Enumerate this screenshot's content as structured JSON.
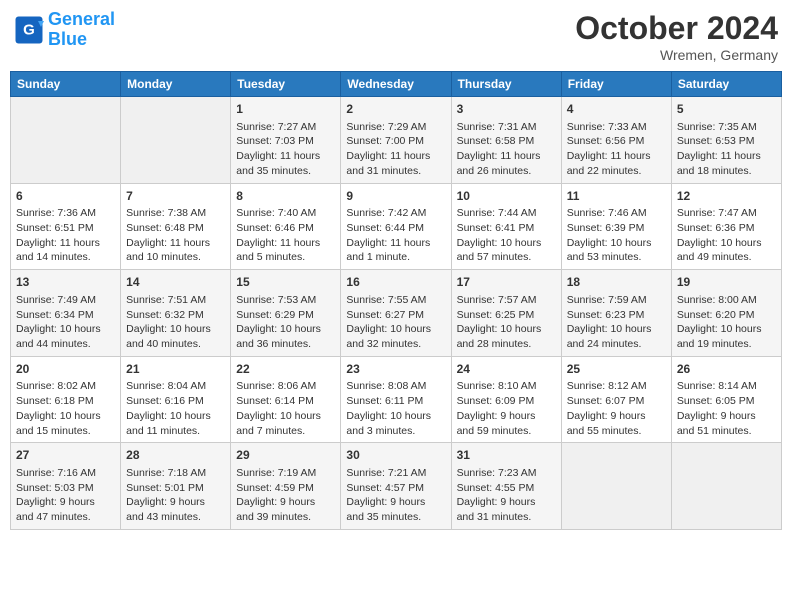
{
  "header": {
    "logo_line1": "General",
    "logo_line2": "Blue",
    "month": "October 2024",
    "location": "Wremen, Germany"
  },
  "weekdays": [
    "Sunday",
    "Monday",
    "Tuesday",
    "Wednesday",
    "Thursday",
    "Friday",
    "Saturday"
  ],
  "weeks": [
    [
      {
        "day": "",
        "info": ""
      },
      {
        "day": "",
        "info": ""
      },
      {
        "day": "1",
        "info": "Sunrise: 7:27 AM\nSunset: 7:03 PM\nDaylight: 11 hours and 35 minutes."
      },
      {
        "day": "2",
        "info": "Sunrise: 7:29 AM\nSunset: 7:00 PM\nDaylight: 11 hours and 31 minutes."
      },
      {
        "day": "3",
        "info": "Sunrise: 7:31 AM\nSunset: 6:58 PM\nDaylight: 11 hours and 26 minutes."
      },
      {
        "day": "4",
        "info": "Sunrise: 7:33 AM\nSunset: 6:56 PM\nDaylight: 11 hours and 22 minutes."
      },
      {
        "day": "5",
        "info": "Sunrise: 7:35 AM\nSunset: 6:53 PM\nDaylight: 11 hours and 18 minutes."
      }
    ],
    [
      {
        "day": "6",
        "info": "Sunrise: 7:36 AM\nSunset: 6:51 PM\nDaylight: 11 hours and 14 minutes."
      },
      {
        "day": "7",
        "info": "Sunrise: 7:38 AM\nSunset: 6:48 PM\nDaylight: 11 hours and 10 minutes."
      },
      {
        "day": "8",
        "info": "Sunrise: 7:40 AM\nSunset: 6:46 PM\nDaylight: 11 hours and 5 minutes."
      },
      {
        "day": "9",
        "info": "Sunrise: 7:42 AM\nSunset: 6:44 PM\nDaylight: 11 hours and 1 minute."
      },
      {
        "day": "10",
        "info": "Sunrise: 7:44 AM\nSunset: 6:41 PM\nDaylight: 10 hours and 57 minutes."
      },
      {
        "day": "11",
        "info": "Sunrise: 7:46 AM\nSunset: 6:39 PM\nDaylight: 10 hours and 53 minutes."
      },
      {
        "day": "12",
        "info": "Sunrise: 7:47 AM\nSunset: 6:36 PM\nDaylight: 10 hours and 49 minutes."
      }
    ],
    [
      {
        "day": "13",
        "info": "Sunrise: 7:49 AM\nSunset: 6:34 PM\nDaylight: 10 hours and 44 minutes."
      },
      {
        "day": "14",
        "info": "Sunrise: 7:51 AM\nSunset: 6:32 PM\nDaylight: 10 hours and 40 minutes."
      },
      {
        "day": "15",
        "info": "Sunrise: 7:53 AM\nSunset: 6:29 PM\nDaylight: 10 hours and 36 minutes."
      },
      {
        "day": "16",
        "info": "Sunrise: 7:55 AM\nSunset: 6:27 PM\nDaylight: 10 hours and 32 minutes."
      },
      {
        "day": "17",
        "info": "Sunrise: 7:57 AM\nSunset: 6:25 PM\nDaylight: 10 hours and 28 minutes."
      },
      {
        "day": "18",
        "info": "Sunrise: 7:59 AM\nSunset: 6:23 PM\nDaylight: 10 hours and 24 minutes."
      },
      {
        "day": "19",
        "info": "Sunrise: 8:00 AM\nSunset: 6:20 PM\nDaylight: 10 hours and 19 minutes."
      }
    ],
    [
      {
        "day": "20",
        "info": "Sunrise: 8:02 AM\nSunset: 6:18 PM\nDaylight: 10 hours and 15 minutes."
      },
      {
        "day": "21",
        "info": "Sunrise: 8:04 AM\nSunset: 6:16 PM\nDaylight: 10 hours and 11 minutes."
      },
      {
        "day": "22",
        "info": "Sunrise: 8:06 AM\nSunset: 6:14 PM\nDaylight: 10 hours and 7 minutes."
      },
      {
        "day": "23",
        "info": "Sunrise: 8:08 AM\nSunset: 6:11 PM\nDaylight: 10 hours and 3 minutes."
      },
      {
        "day": "24",
        "info": "Sunrise: 8:10 AM\nSunset: 6:09 PM\nDaylight: 9 hours and 59 minutes."
      },
      {
        "day": "25",
        "info": "Sunrise: 8:12 AM\nSunset: 6:07 PM\nDaylight: 9 hours and 55 minutes."
      },
      {
        "day": "26",
        "info": "Sunrise: 8:14 AM\nSunset: 6:05 PM\nDaylight: 9 hours and 51 minutes."
      }
    ],
    [
      {
        "day": "27",
        "info": "Sunrise: 7:16 AM\nSunset: 5:03 PM\nDaylight: 9 hours and 47 minutes."
      },
      {
        "day": "28",
        "info": "Sunrise: 7:18 AM\nSunset: 5:01 PM\nDaylight: 9 hours and 43 minutes."
      },
      {
        "day": "29",
        "info": "Sunrise: 7:19 AM\nSunset: 4:59 PM\nDaylight: 9 hours and 39 minutes."
      },
      {
        "day": "30",
        "info": "Sunrise: 7:21 AM\nSunset: 4:57 PM\nDaylight: 9 hours and 35 minutes."
      },
      {
        "day": "31",
        "info": "Sunrise: 7:23 AM\nSunset: 4:55 PM\nDaylight: 9 hours and 31 minutes."
      },
      {
        "day": "",
        "info": ""
      },
      {
        "day": "",
        "info": ""
      }
    ]
  ]
}
